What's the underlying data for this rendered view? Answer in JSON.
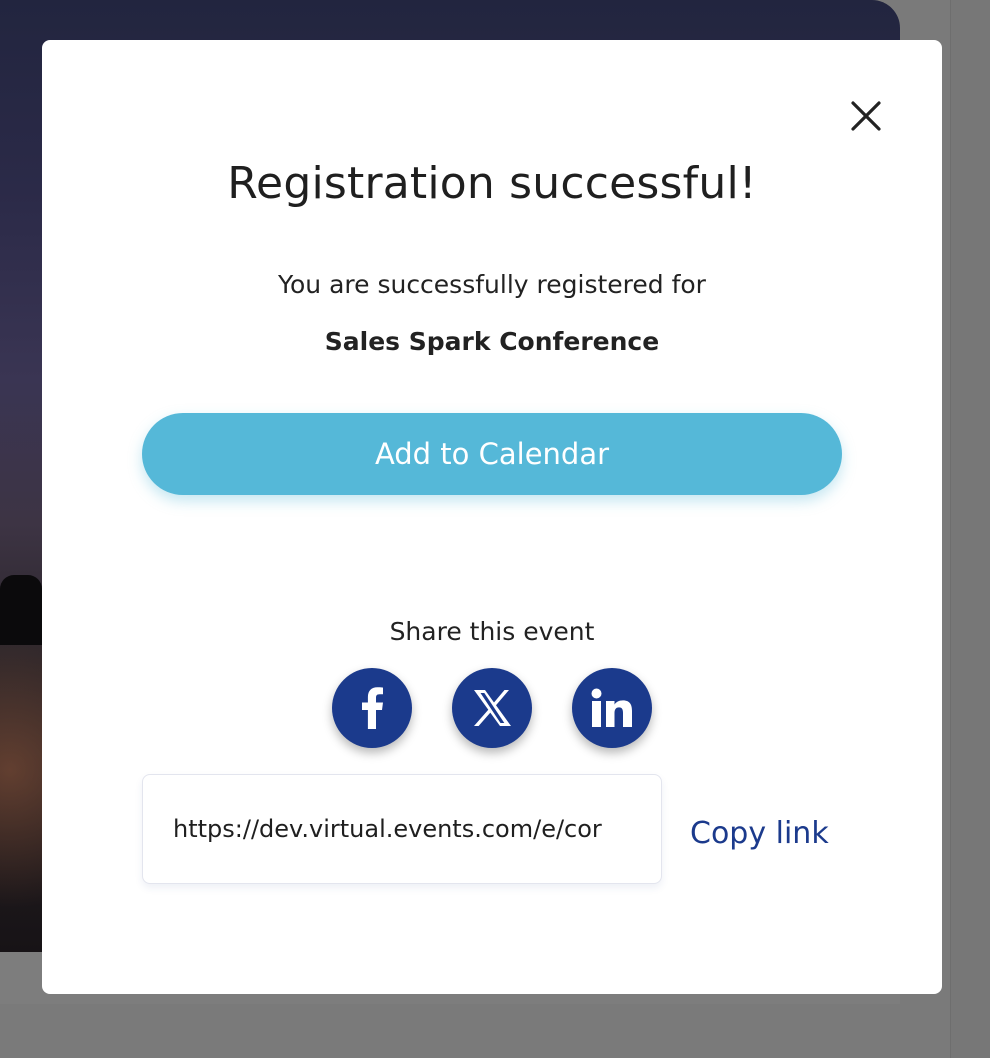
{
  "modal": {
    "title": "Registration successful!",
    "subtitle": "You are successfully registered for",
    "event_name": "Sales Spark Conference",
    "add_to_calendar_label": "Add to Calendar",
    "share_label": "Share this event",
    "share_link_value": "https://dev.virtual.events.com/e/cor",
    "copy_link_label": "Copy link",
    "social": [
      {
        "name": "facebook",
        "icon": "facebook-icon"
      },
      {
        "name": "x",
        "icon": "x-icon"
      },
      {
        "name": "linkedin",
        "icon": "linkedin-icon"
      }
    ],
    "close_icon": "close-icon"
  },
  "colors": {
    "accent_button": "#55b8d8",
    "brand_navy": "#1b3a8c",
    "overlay": "#7a7a7a"
  }
}
